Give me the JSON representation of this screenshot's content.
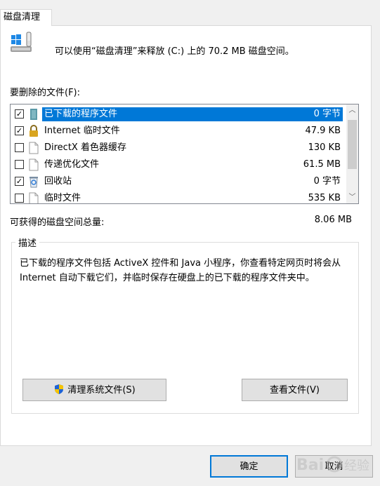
{
  "tab": {
    "label": "磁盘清理"
  },
  "header": {
    "text": "可以使用“磁盘清理”来释放 (C:) 上的 70.2 MB 磁盘空间。"
  },
  "list": {
    "label": "要删除的文件(F):",
    "items": [
      {
        "name": "已下载的程序文件",
        "size": "0 字节",
        "checked": true,
        "selected": true,
        "icon": "program-files-icon"
      },
      {
        "name": "Internet 临时文件",
        "size": "47.9 KB",
        "checked": true,
        "selected": false,
        "icon": "lock-icon"
      },
      {
        "name": "DirectX 着色器缓存",
        "size": "130 KB",
        "checked": false,
        "selected": false,
        "icon": "file-icon"
      },
      {
        "name": "传递优化文件",
        "size": "61.5 MB",
        "checked": false,
        "selected": false,
        "icon": "file-icon"
      },
      {
        "name": "回收站",
        "size": "0 字节",
        "checked": true,
        "selected": false,
        "icon": "recycle-bin-icon"
      },
      {
        "name": "临时文件",
        "size": "535 KB",
        "checked": false,
        "selected": false,
        "icon": "file-icon"
      }
    ]
  },
  "total": {
    "label": "可获得的磁盘空间总量:",
    "value": "8.06 MB"
  },
  "description": {
    "title": "描述",
    "text": "已下载的程序文件包括 ActiveX 控件和 Java 小程序，你查看特定网页时将会从 Internet 自动下载它们，并临时保存在硬盘上的已下载的程序文件夹中。"
  },
  "buttons": {
    "clean_system": "清理系统文件(S)",
    "view_files": "查看文件(V)",
    "ok": "确定",
    "cancel": "取消"
  },
  "colors": {
    "selection": "#0078d7",
    "background": "#f0f0f0"
  }
}
